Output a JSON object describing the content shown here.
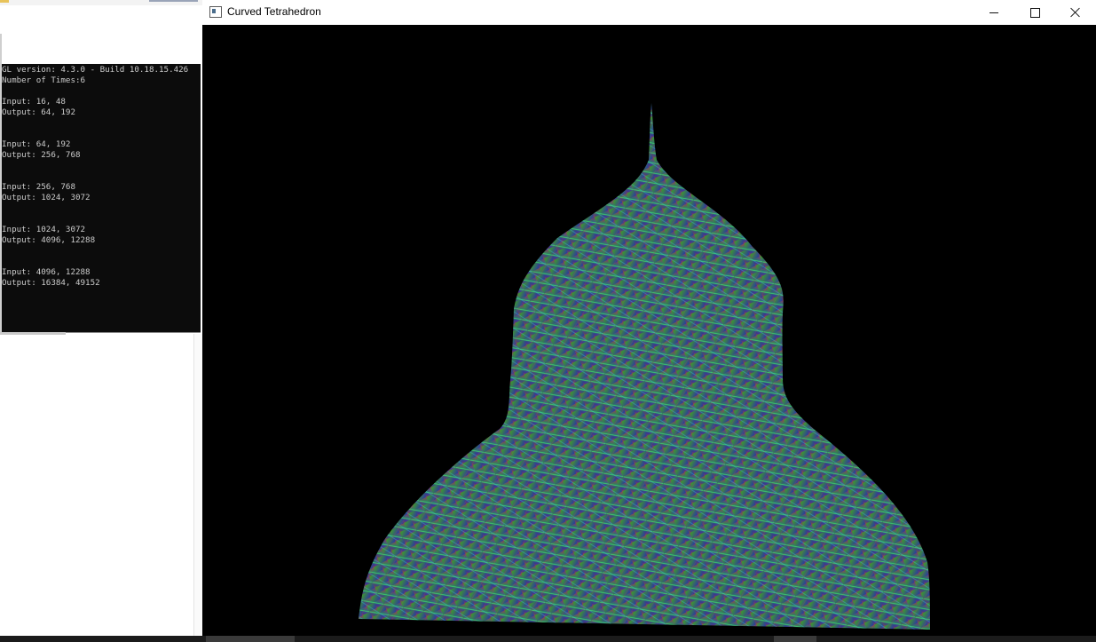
{
  "window": {
    "title": "Curved Tetrahedron",
    "icon": "app-window-icon",
    "controls": [
      "minimize-icon",
      "maximize-icon",
      "close-icon"
    ]
  },
  "console": {
    "lines": [
      "GL version: 4.3.0 - Build 10.18.15.426",
      "Number of Times:6",
      "",
      "Input: 16, 48",
      "Output: 64, 192",
      "",
      "",
      "Input: 64, 192",
      "Output: 256, 768",
      "",
      "",
      "Input: 256, 768",
      "Output: 1024, 3072",
      "",
      "",
      "Input: 1024, 3072",
      "Output: 4096, 12288",
      "",
      "",
      "Input: 4096, 12288",
      "Output: 16384, 49152"
    ]
  },
  "render": {
    "background": "#000000",
    "pattern_colors": [
      "#c0392b",
      "#2ecc71",
      "#2c3e9e",
      "#8e44ad",
      "#16a085",
      "#7d3c98"
    ]
  }
}
